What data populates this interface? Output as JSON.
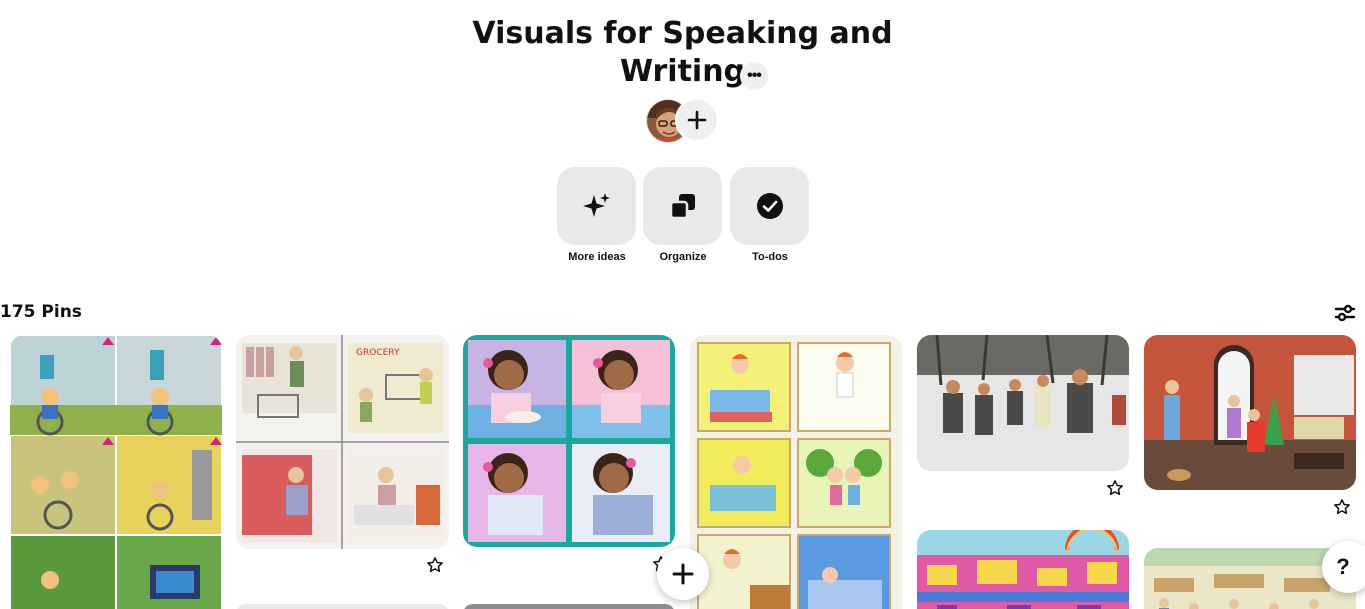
{
  "board": {
    "title_line1": "Visuals for Speaking and",
    "title_line2": "Writing",
    "more_label": "•••"
  },
  "actions": [
    {
      "label": "More ideas",
      "icon": "sparkle-icon"
    },
    {
      "label": "Organize",
      "icon": "organize-icon"
    },
    {
      "label": "To-dos",
      "icon": "checkmark-icon"
    }
  ],
  "pins": {
    "count_label": "175 Pins"
  },
  "help": {
    "label": "?"
  },
  "colors": {
    "tile_bg": "#e9e9e9",
    "text": "#111111"
  }
}
